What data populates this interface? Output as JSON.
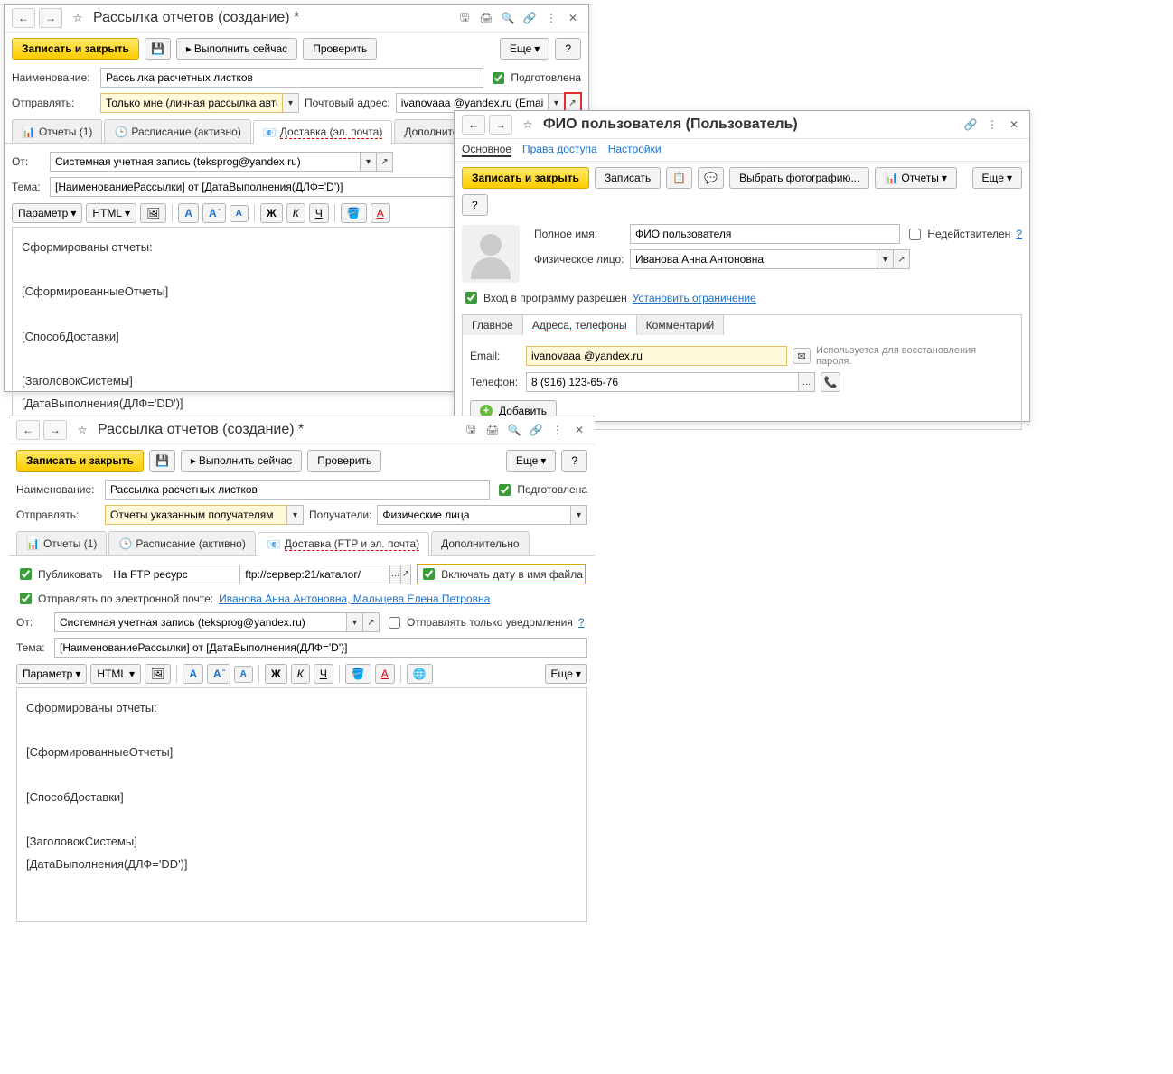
{
  "w1": {
    "title": "Рассылка отчетов (создание) *",
    "save_close": "Записать и закрыть",
    "run_now": "Выполнить сейчас",
    "check": "Проверить",
    "more": "Еще",
    "help": "?",
    "name_label": "Наименование:",
    "name_value": "Рассылка расчетных листков",
    "prepared": "Подготовлена",
    "send_label": "Отправлять:",
    "send_value": "Только мне (личная рассылка автора)",
    "email_label": "Почтовый адрес:",
    "email_value": "ivanovaaa @yandex.ru (Email)",
    "tabs": {
      "reports": "Отчеты (1)",
      "schedule": "Расписание (активно)",
      "delivery": "Доставка (эл. почта)",
      "additional": "Дополнительно"
    },
    "from_label": "От:",
    "from_value": "Системная учетная запись (teksprog@yandex.ru)",
    "subject_label": "Тема:",
    "subject_value": "[НаименованиеРассылки] от [ДатаВыполнения(ДЛФ='D')]",
    "param": "Параметр",
    "html": "HTML",
    "body": {
      "l1": "Сформированы отчеты:",
      "l2": "[СформированныеОтчеты]",
      "l3": "[СпособДоставки]",
      "l4": "[ЗаголовокСистемы]",
      "l5": "[ДатаВыполнения(ДЛФ='DD')]"
    }
  },
  "w2": {
    "title": "ФИО пользователя (Пользователь)",
    "sections": {
      "main": "Основное",
      "access": "Права доступа",
      "settings": "Настройки"
    },
    "save_close": "Записать и закрыть",
    "save": "Записать",
    "choose_photo": "Выбрать фотографию...",
    "reports": "Отчеты",
    "more": "Еще",
    "help": "?",
    "fullname_label": "Полное имя:",
    "fullname_value": "ФИО пользователя",
    "invalid": "Недействителен",
    "person_label": "Физическое лицо:",
    "person_value": "Иванова Анна Антоновна",
    "login_allowed": "Вход в программу разрешен",
    "set_limit": "Установить ограничение",
    "tabs": {
      "main": "Главное",
      "addr": "Адреса, телефоны",
      "comment": "Комментарий"
    },
    "email_label": "Email:",
    "email_value": "ivanovaaa @yandex.ru",
    "email_hint": "Используется для восстановления пароля.",
    "phone_label": "Телефон:",
    "phone_value": "8 (916) 123-65-76",
    "add": "Добавить"
  },
  "w3": {
    "title": "Рассылка отчетов (создание) *",
    "save_close": "Записать и закрыть",
    "run_now": "Выполнить сейчас",
    "check": "Проверить",
    "more": "Еще",
    "help": "?",
    "name_label": "Наименование:",
    "name_value": "Рассылка расчетных листков",
    "prepared": "Подготовлена",
    "send_label": "Отправлять:",
    "send_value": "Отчеты указанным получателям",
    "recipients_label": "Получатели:",
    "recipients_value": "Физические лица",
    "tabs": {
      "reports": "Отчеты (1)",
      "schedule": "Расписание (активно)",
      "delivery": "Доставка (FTP и эл. почта)",
      "additional": "Дополнительно"
    },
    "publish": "Публиковать",
    "publish_target": "На FTP ресурс",
    "ftp_url": "ftp://сервер:21/каталог/",
    "include_date": "Включать дату в имя файла",
    "send_email": "Отправлять по электронной почте:",
    "email_recipients": "Иванова Анна Антоновна, Мальцева Елена Петровна",
    "from_label": "От:",
    "from_value": "Системная учетная запись (teksprog@yandex.ru)",
    "notify_only": "Отправлять только уведомления",
    "subject_label": "Тема:",
    "subject_value": "[НаименованиеРассылки] от [ДатаВыполнения(ДЛФ='D')]",
    "param": "Параметр",
    "html": "HTML",
    "body": {
      "l1": "Сформированы отчеты:",
      "l2": "[СформированныеОтчеты]",
      "l3": "[СпособДоставки]",
      "l4": "[ЗаголовокСистемы]",
      "l5": "[ДатаВыполнения(ДЛФ='DD')]"
    }
  }
}
